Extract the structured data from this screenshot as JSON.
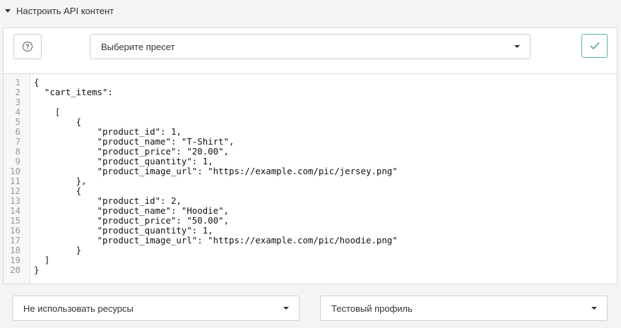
{
  "section": {
    "title": "Настроить API контент"
  },
  "toolbar": {
    "preset_value": "Выберите пресет"
  },
  "editor": {
    "lines": [
      "{",
      "  \"cart_items\":",
      "",
      "    [",
      "        {",
      "            \"product_id\": 1,",
      "            \"product_name\": \"T-Shirt\",",
      "            \"product_price\": \"20.00\",",
      "            \"product_quantity\": 1,",
      "            \"product_image_url\": \"https://example.com/pic/jersey.png\"",
      "        },",
      "        {",
      "            \"product_id\": 2,",
      "            \"product_name\": \"Hoodie\",",
      "            \"product_price\": \"50.00\",",
      "            \"product_quantity\": 1,",
      "            \"product_image_url\": \"https://example.com/pic/hoodie.png\"",
      "        }",
      "  ]",
      "}"
    ]
  },
  "footer": {
    "resources_value": "Не использовать ресурсы",
    "profile_value": "Тестовый профиль"
  },
  "colors": {
    "accent": "#5cb3a5"
  },
  "icons": {
    "section_toggle": "caret-down-icon",
    "help": "question-circle-icon",
    "apply": "check-icon",
    "dropdown": "chevron-down-icon"
  }
}
